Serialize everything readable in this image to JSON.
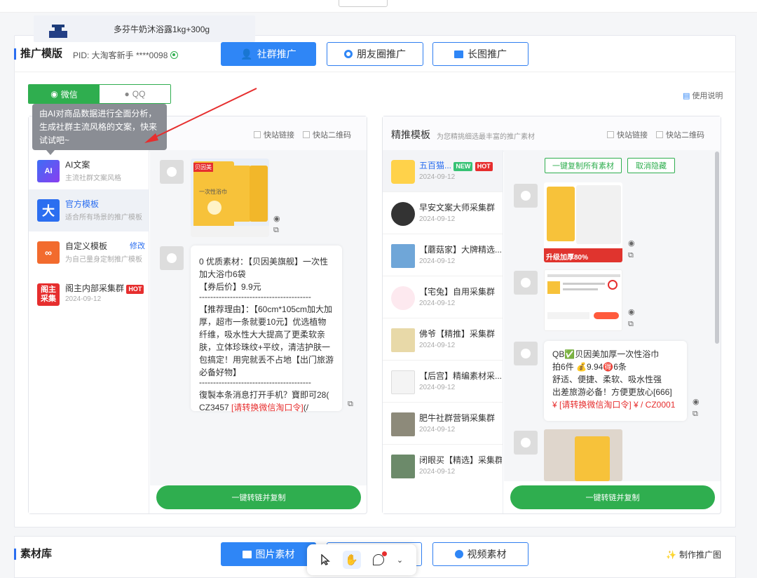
{
  "top": {
    "button_label": "",
    "product_name": "多芬牛奶沐浴露1kg+300g"
  },
  "promo": {
    "title": "推广模版",
    "pid_label": "PID: 大淘客新手 ****0098",
    "tabs": [
      {
        "label": "社群推广",
        "icon": "users-icon",
        "active": true
      },
      {
        "label": "朋友圈推广",
        "icon": "moments-icon",
        "active": false
      },
      {
        "label": "长图推广",
        "icon": "image-icon",
        "active": false
      }
    ],
    "platform": {
      "wechat": "微信",
      "qq": "QQ"
    },
    "usage": "使用说明",
    "tooltip": "由AI对商品数据进行全面分析，生成社群主流风格的文案，快来试试吧~"
  },
  "left_card": {
    "quick_link": "快站链接",
    "quick_qr": "快站二维码",
    "items": [
      {
        "icon_text": "AI",
        "title": "AI文案",
        "sub": "主流社群文案风格",
        "color": "#5b3ff0"
      },
      {
        "icon_text": "大",
        "title": "官方模板",
        "sub": "适合所有场景的推广模板",
        "color": "#2b6ef0"
      },
      {
        "icon_text": "",
        "title": "自定义模板",
        "sub": "为自己量身定制推广模板",
        "edit": "修改",
        "color": "#f26b2e"
      },
      {
        "icon_text": "阁主采集",
        "title": "阁主内部采集群",
        "sub": "2024-09-12",
        "badge": "HOT",
        "color": "#e62e2e"
      }
    ],
    "product_img_text": "一次性浴巾",
    "msg": {
      "line1": "0 优质素材：【贝因美旗舰】一次性加大浴巾6袋",
      "line2": "【券后价】9.9元",
      "sep": "----------------------------------------",
      "line3": "【推荐理由】：【60cm*105cm加大加厚，超市一条就要10元】优选植物纤维，吸水性大大提高了更柔软亲肤，立体珍珠纹+平纹，清洁护肤一包搞定！用完就丢不占地【出门旅游必备好物】",
      "line4": "復製本条消息打开手机？寶即可28( CZ3457",
      "line4_red": "[请转换微信淘口令]",
      "line4_end": "(/"
    },
    "copy_button": "一键转链并复制"
  },
  "right_card": {
    "title": "精推模板",
    "subtitle": "为您精挑细选最丰富的推广素材",
    "quick_link": "快站链接",
    "quick_qr": "快站二维码",
    "groups": [
      {
        "name": "五百猫...",
        "date": "2024-09-12",
        "badges": [
          "NEW",
          "HOT"
        ]
      },
      {
        "name": "早安文案大师采集群",
        "date": "2024-09-12"
      },
      {
        "name": "【蘑菇家】大牌精选...",
        "date": "2024-09-12"
      },
      {
        "name": "【宅兔】自用采集群",
        "date": "2024-09-12"
      },
      {
        "name": "佛爷【精推】采集群",
        "date": "2024-09-12"
      },
      {
        "name": "【后宫】精编素材采...",
        "date": "2024-09-12"
      },
      {
        "name": "肥牛社群营销采集群",
        "date": "2024-09-12"
      },
      {
        "name": "闭眼买【精选】采集群",
        "date": "2024-09-12"
      }
    ],
    "copy_all": "一键复制所有素材",
    "cancel_hide": "取消隐藏",
    "img_caption": "升级加厚80%",
    "msg": {
      "l1": "QB✅贝因美加厚一次性浴巾",
      "l2": "拍6件 💰9.94🉐6条",
      "l3": "舒适、便捷、柔软、吸水性强",
      "l4": "出差旅游必备！方便更放心[666]",
      "l5": "¥ [请转换微信淘口令] ¥ / CZ0001"
    },
    "copy_button": "一键转链并复制"
  },
  "materials": {
    "title": "素材库",
    "tabs": [
      {
        "label": "图片素材",
        "icon": "image-icon",
        "active": true
      },
      {
        "label": "",
        "active": false
      },
      {
        "label": "视频素材",
        "icon": "video-icon",
        "active": false
      }
    ],
    "make_poster": "制作推广图"
  },
  "toolbar": {
    "items": [
      "pointer-icon",
      "hand-icon",
      "lasso-icon",
      "chevron-down-icon"
    ]
  },
  "colors": {
    "accent": "#2f86f6",
    "green": "#2fae4f",
    "red": "#e62e2e"
  }
}
